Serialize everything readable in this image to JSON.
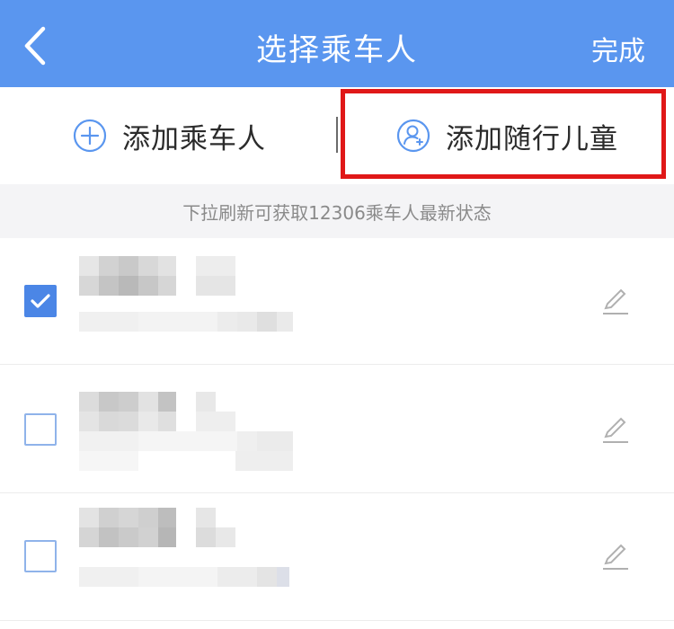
{
  "header": {
    "title": "选择乘车人",
    "done_label": "完成",
    "bg_color": "#5a96ef"
  },
  "actions": {
    "add_passenger_label": "添加乘车人",
    "add_child_label": "添加随行儿童"
  },
  "info": {
    "text": "下拉刷新可获取12306乘车人最新状态"
  },
  "passengers": [
    {
      "checked": true
    },
    {
      "checked": false
    },
    {
      "checked": false
    }
  ],
  "colors": {
    "accent": "#4b86e6",
    "highlight": "#e01818"
  }
}
